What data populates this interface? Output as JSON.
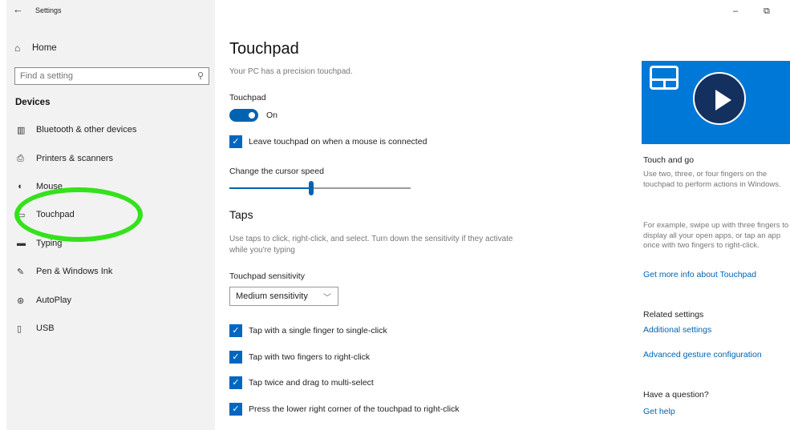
{
  "window": {
    "title": "Settings",
    "minimize": "–",
    "restore": "⧉"
  },
  "sidebar": {
    "home_label": "Home",
    "search_placeholder": "Find a setting",
    "section": "Devices",
    "items": [
      {
        "label": "Bluetooth & other devices",
        "icon": "bluetooth-keyboard-icon"
      },
      {
        "label": "Printers & scanners",
        "icon": "printer-icon"
      },
      {
        "label": "Mouse",
        "icon": "mouse-icon"
      },
      {
        "label": "Touchpad",
        "icon": "touchpad-icon"
      },
      {
        "label": "Typing",
        "icon": "keyboard-icon"
      },
      {
        "label": "Pen & Windows Ink",
        "icon": "pen-icon"
      },
      {
        "label": "AutoPlay",
        "icon": "autoplay-icon"
      },
      {
        "label": "USB",
        "icon": "usb-icon"
      }
    ],
    "highlight_color": "#33e21a"
  },
  "main": {
    "title": "Touchpad",
    "subtitle": "Your PC has a precision touchpad.",
    "touchpad_label": "Touchpad",
    "toggle_state": "On",
    "leave_on_label": "Leave touchpad on when a mouse is connected",
    "cursor_speed_label": "Change the cursor speed",
    "cursor_speed_fraction": 0.45,
    "taps_heading": "Taps",
    "taps_desc": "Use taps to click, right-click, and select. Turn down the sensitivity if they activate while you're typing",
    "sensitivity_label": "Touchpad sensitivity",
    "sensitivity_value": "Medium sensitivity",
    "tap_options": [
      "Tap with a single finger to single-click",
      "Tap with two fingers to right-click",
      "Tap twice and drag to multi-select",
      "Press the lower right corner of the touchpad to right-click"
    ],
    "accent_color": "#0063b1"
  },
  "right": {
    "touch_go_heading": "Touch and go",
    "touch_go_text": "Use two, three, or four fingers on the touchpad to perform actions in Windows.",
    "example_text": "For example, swipe up with three fingers to display all your open apps, or tap an app once with two fingers to right-click.",
    "more_info_link": "Get more info about Touchpad",
    "related_heading": "Related settings",
    "additional_link": "Additional settings",
    "advanced_link": "Advanced gesture configuration",
    "question_heading": "Have a question?",
    "help_link": "Get help"
  }
}
